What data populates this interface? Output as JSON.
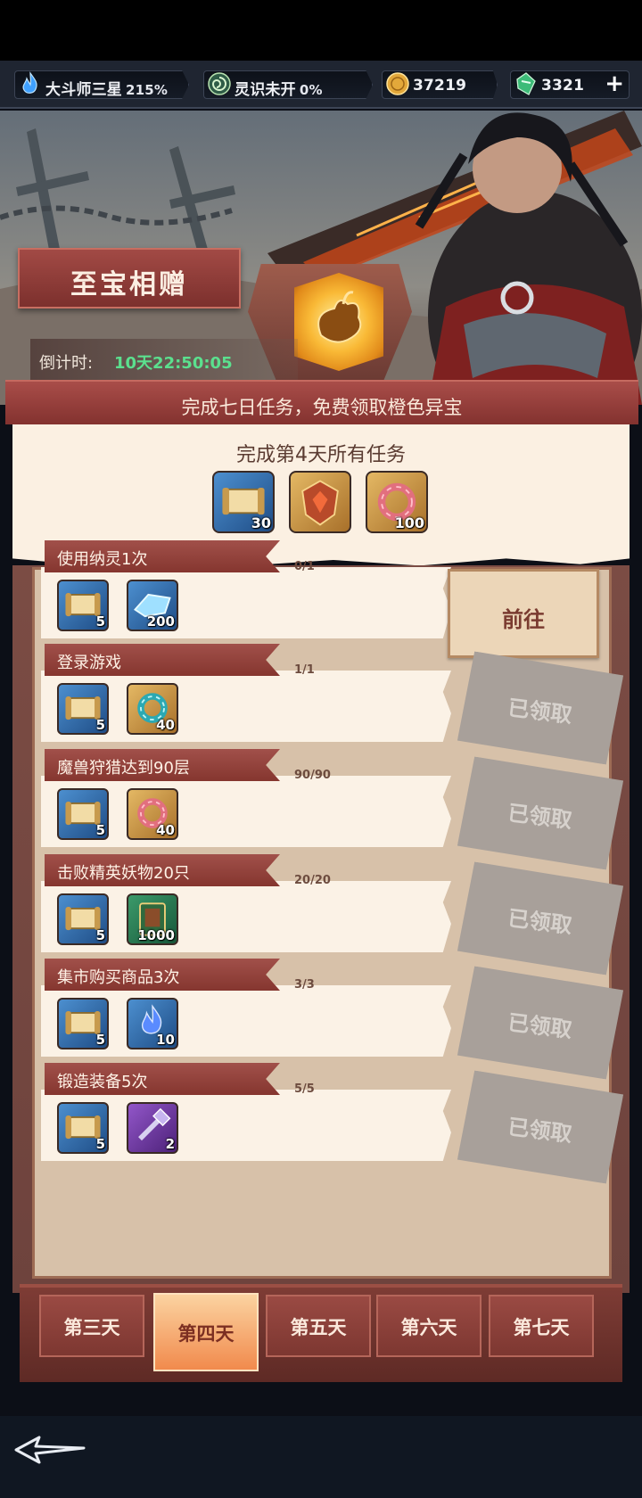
{
  "resources": [
    {
      "icon": "blue-flame-icon",
      "label": "大斗师三星",
      "value": "215%"
    },
    {
      "icon": "green-spiral-icon",
      "label": "灵识未开",
      "value": "0%"
    },
    {
      "icon": "gold-coin-icon",
      "label": "37219",
      "value": ""
    },
    {
      "icon": "jade-icon",
      "label": "3321",
      "value": ""
    }
  ],
  "plus_label": "+",
  "event": {
    "title": "至宝相赠",
    "countdown_label": "倒计时:",
    "countdown_value": "10天22:50:05",
    "slogan": "完成七日任务，免费领取橙色异宝"
  },
  "day_reward": {
    "title": "完成第4天所有任务",
    "items": [
      {
        "icon": "scroll-icon",
        "quality": "blue",
        "count": "30"
      },
      {
        "icon": "gem-badge-icon",
        "quality": "gold",
        "count": ""
      },
      {
        "icon": "pink-ring-icon",
        "quality": "gold",
        "count": "100"
      }
    ]
  },
  "tasks": [
    {
      "name": "使用纳灵1次",
      "progress": "0/1",
      "status": "go",
      "status_label": "前往",
      "rewards": [
        {
          "icon": "scroll-icon",
          "quality": "blue",
          "count": "5"
        },
        {
          "icon": "crystal-icon",
          "quality": "blue",
          "count": "200"
        }
      ]
    },
    {
      "name": "登录游戏",
      "progress": "1/1",
      "status": "claimed",
      "status_label": "已领取",
      "rewards": [
        {
          "icon": "scroll-icon",
          "quality": "blue",
          "count": "5"
        },
        {
          "icon": "teal-ring-icon",
          "quality": "gold",
          "count": "40"
        }
      ]
    },
    {
      "name": "魔兽狩猎达到90层",
      "progress": "90/90",
      "status": "claimed",
      "status_label": "已领取",
      "rewards": [
        {
          "icon": "scroll-icon",
          "quality": "blue",
          "count": "5"
        },
        {
          "icon": "pink-ring-icon",
          "quality": "gold",
          "count": "40"
        }
      ]
    },
    {
      "name": "击败精英妖物20只",
      "progress": "20/20",
      "status": "claimed",
      "status_label": "已领取",
      "rewards": [
        {
          "icon": "scroll-icon",
          "quality": "blue",
          "count": "5"
        },
        {
          "icon": "green-book-icon",
          "quality": "green",
          "count": "1000"
        }
      ]
    },
    {
      "name": "集市购买商品3次",
      "progress": "3/3",
      "status": "claimed",
      "status_label": "已领取",
      "rewards": [
        {
          "icon": "scroll-icon",
          "quality": "blue",
          "count": "5"
        },
        {
          "icon": "blue-flame-icon",
          "quality": "blue",
          "count": "10"
        }
      ]
    },
    {
      "name": "锻造装备5次",
      "progress": "5/5",
      "status": "claimed",
      "status_label": "已领取",
      "rewards": [
        {
          "icon": "scroll-icon",
          "quality": "blue",
          "count": "5"
        },
        {
          "icon": "hammer-icon",
          "quality": "purple",
          "count": "2"
        }
      ]
    }
  ],
  "tabs": [
    {
      "label": "第三天",
      "active": false
    },
    {
      "label": "第四天",
      "active": true
    },
    {
      "label": "第五天",
      "active": false
    },
    {
      "label": "第六天",
      "active": false
    },
    {
      "label": "第七天",
      "active": false
    }
  ],
  "colors": {
    "accent_red": "#a1504a",
    "timer_green": "#5be08e",
    "active_tab": "#f18a4d"
  }
}
